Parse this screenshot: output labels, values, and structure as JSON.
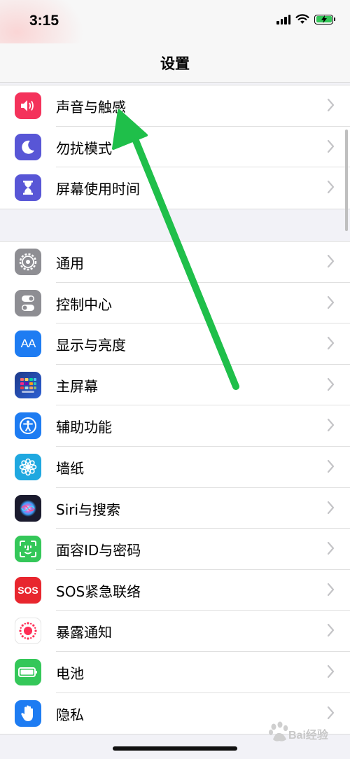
{
  "status_bar": {
    "time": "3:15",
    "icons": [
      "cellular-signal-icon",
      "wifi-icon",
      "battery-charging-icon"
    ]
  },
  "nav": {
    "title": "设置"
  },
  "groups": [
    {
      "items": [
        {
          "label": "声音与触感",
          "icon": "speaker-icon",
          "color": "#f4325b"
        },
        {
          "label": "勿扰模式",
          "icon": "moon-icon",
          "color": "#5856d6"
        },
        {
          "label": "屏幕使用时间",
          "icon": "hourglass-icon",
          "color": "#5856d6"
        }
      ]
    },
    {
      "items": [
        {
          "label": "通用",
          "icon": "gear-icon",
          "color": "#8e8e93"
        },
        {
          "label": "控制中心",
          "icon": "toggles-icon",
          "color": "#8e8e93"
        },
        {
          "label": "显示与亮度",
          "icon": "text-size-icon",
          "color": "#1e7cf2",
          "icon_text": "AA"
        },
        {
          "label": "主屏幕",
          "icon": "home-screen-grid-icon",
          "color": "#2c5fd3"
        },
        {
          "label": "辅助功能",
          "icon": "accessibility-icon",
          "color": "#1e7cf2"
        },
        {
          "label": "墙纸",
          "icon": "flower-icon",
          "color": "#1fa8e0"
        },
        {
          "label": "Siri与搜索",
          "icon": "siri-icon",
          "color": "#1b1b2e"
        },
        {
          "label": "面容ID与密码",
          "icon": "face-id-icon",
          "color": "#34c759"
        },
        {
          "label": "SOS紧急联络",
          "icon": "sos-icon",
          "color": "#e8262e",
          "icon_text": "SOS"
        },
        {
          "label": "暴露通知",
          "icon": "exposure-notification-icon",
          "color": "#ffffff"
        },
        {
          "label": "电池",
          "icon": "battery-icon",
          "color": "#34c759"
        },
        {
          "label": "隐私",
          "icon": "hand-icon",
          "color": "#1e7cf2"
        }
      ]
    }
  ],
  "annotation": {
    "color": "#1fbf4a"
  },
  "watermark": {
    "text": "Bai经验"
  }
}
